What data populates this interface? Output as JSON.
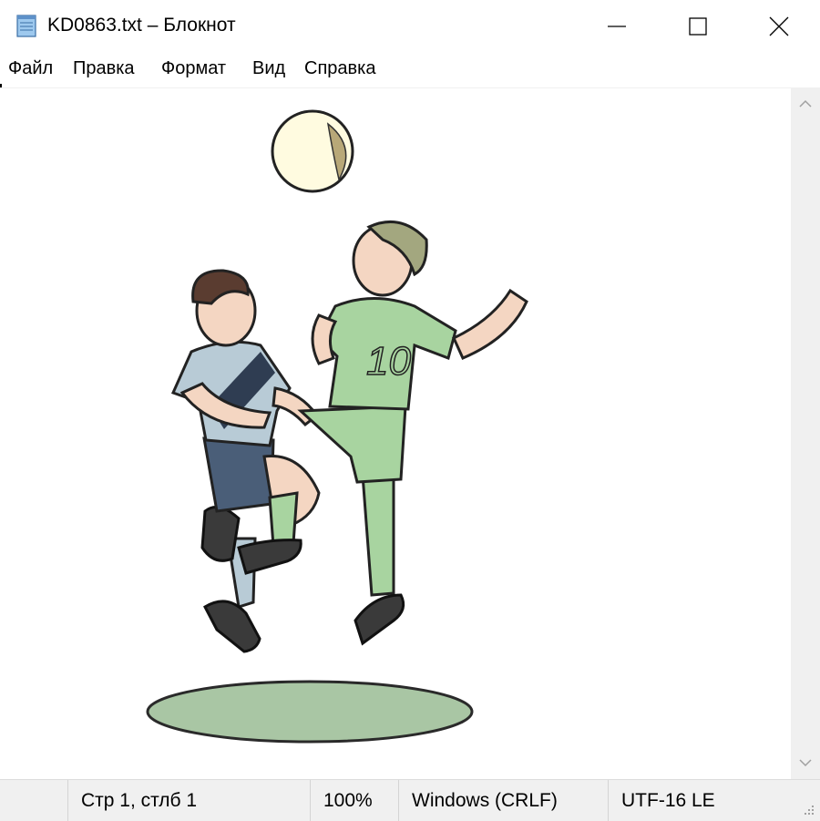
{
  "window": {
    "title": "KD0863.txt – Блокнот"
  },
  "menu": {
    "items": [
      "Файл",
      "Правка",
      "Формат",
      "Вид",
      "Справка"
    ]
  },
  "illustration": {
    "jersey_number": "10"
  },
  "status": {
    "position": "Стр 1, стлб 1",
    "zoom": "100%",
    "line_endings": "Windows (CRLF)",
    "encoding": "UTF-16 LE"
  },
  "colors": {
    "green_player": "#a8d4a0",
    "shadow": "#a9c6a4",
    "blue_player": "#b8cbd6",
    "dark_stripe": "#2f3d52",
    "hair_brown": "#5a3c30",
    "skin": "#f4d6c2",
    "ball": "#fffbe0"
  }
}
